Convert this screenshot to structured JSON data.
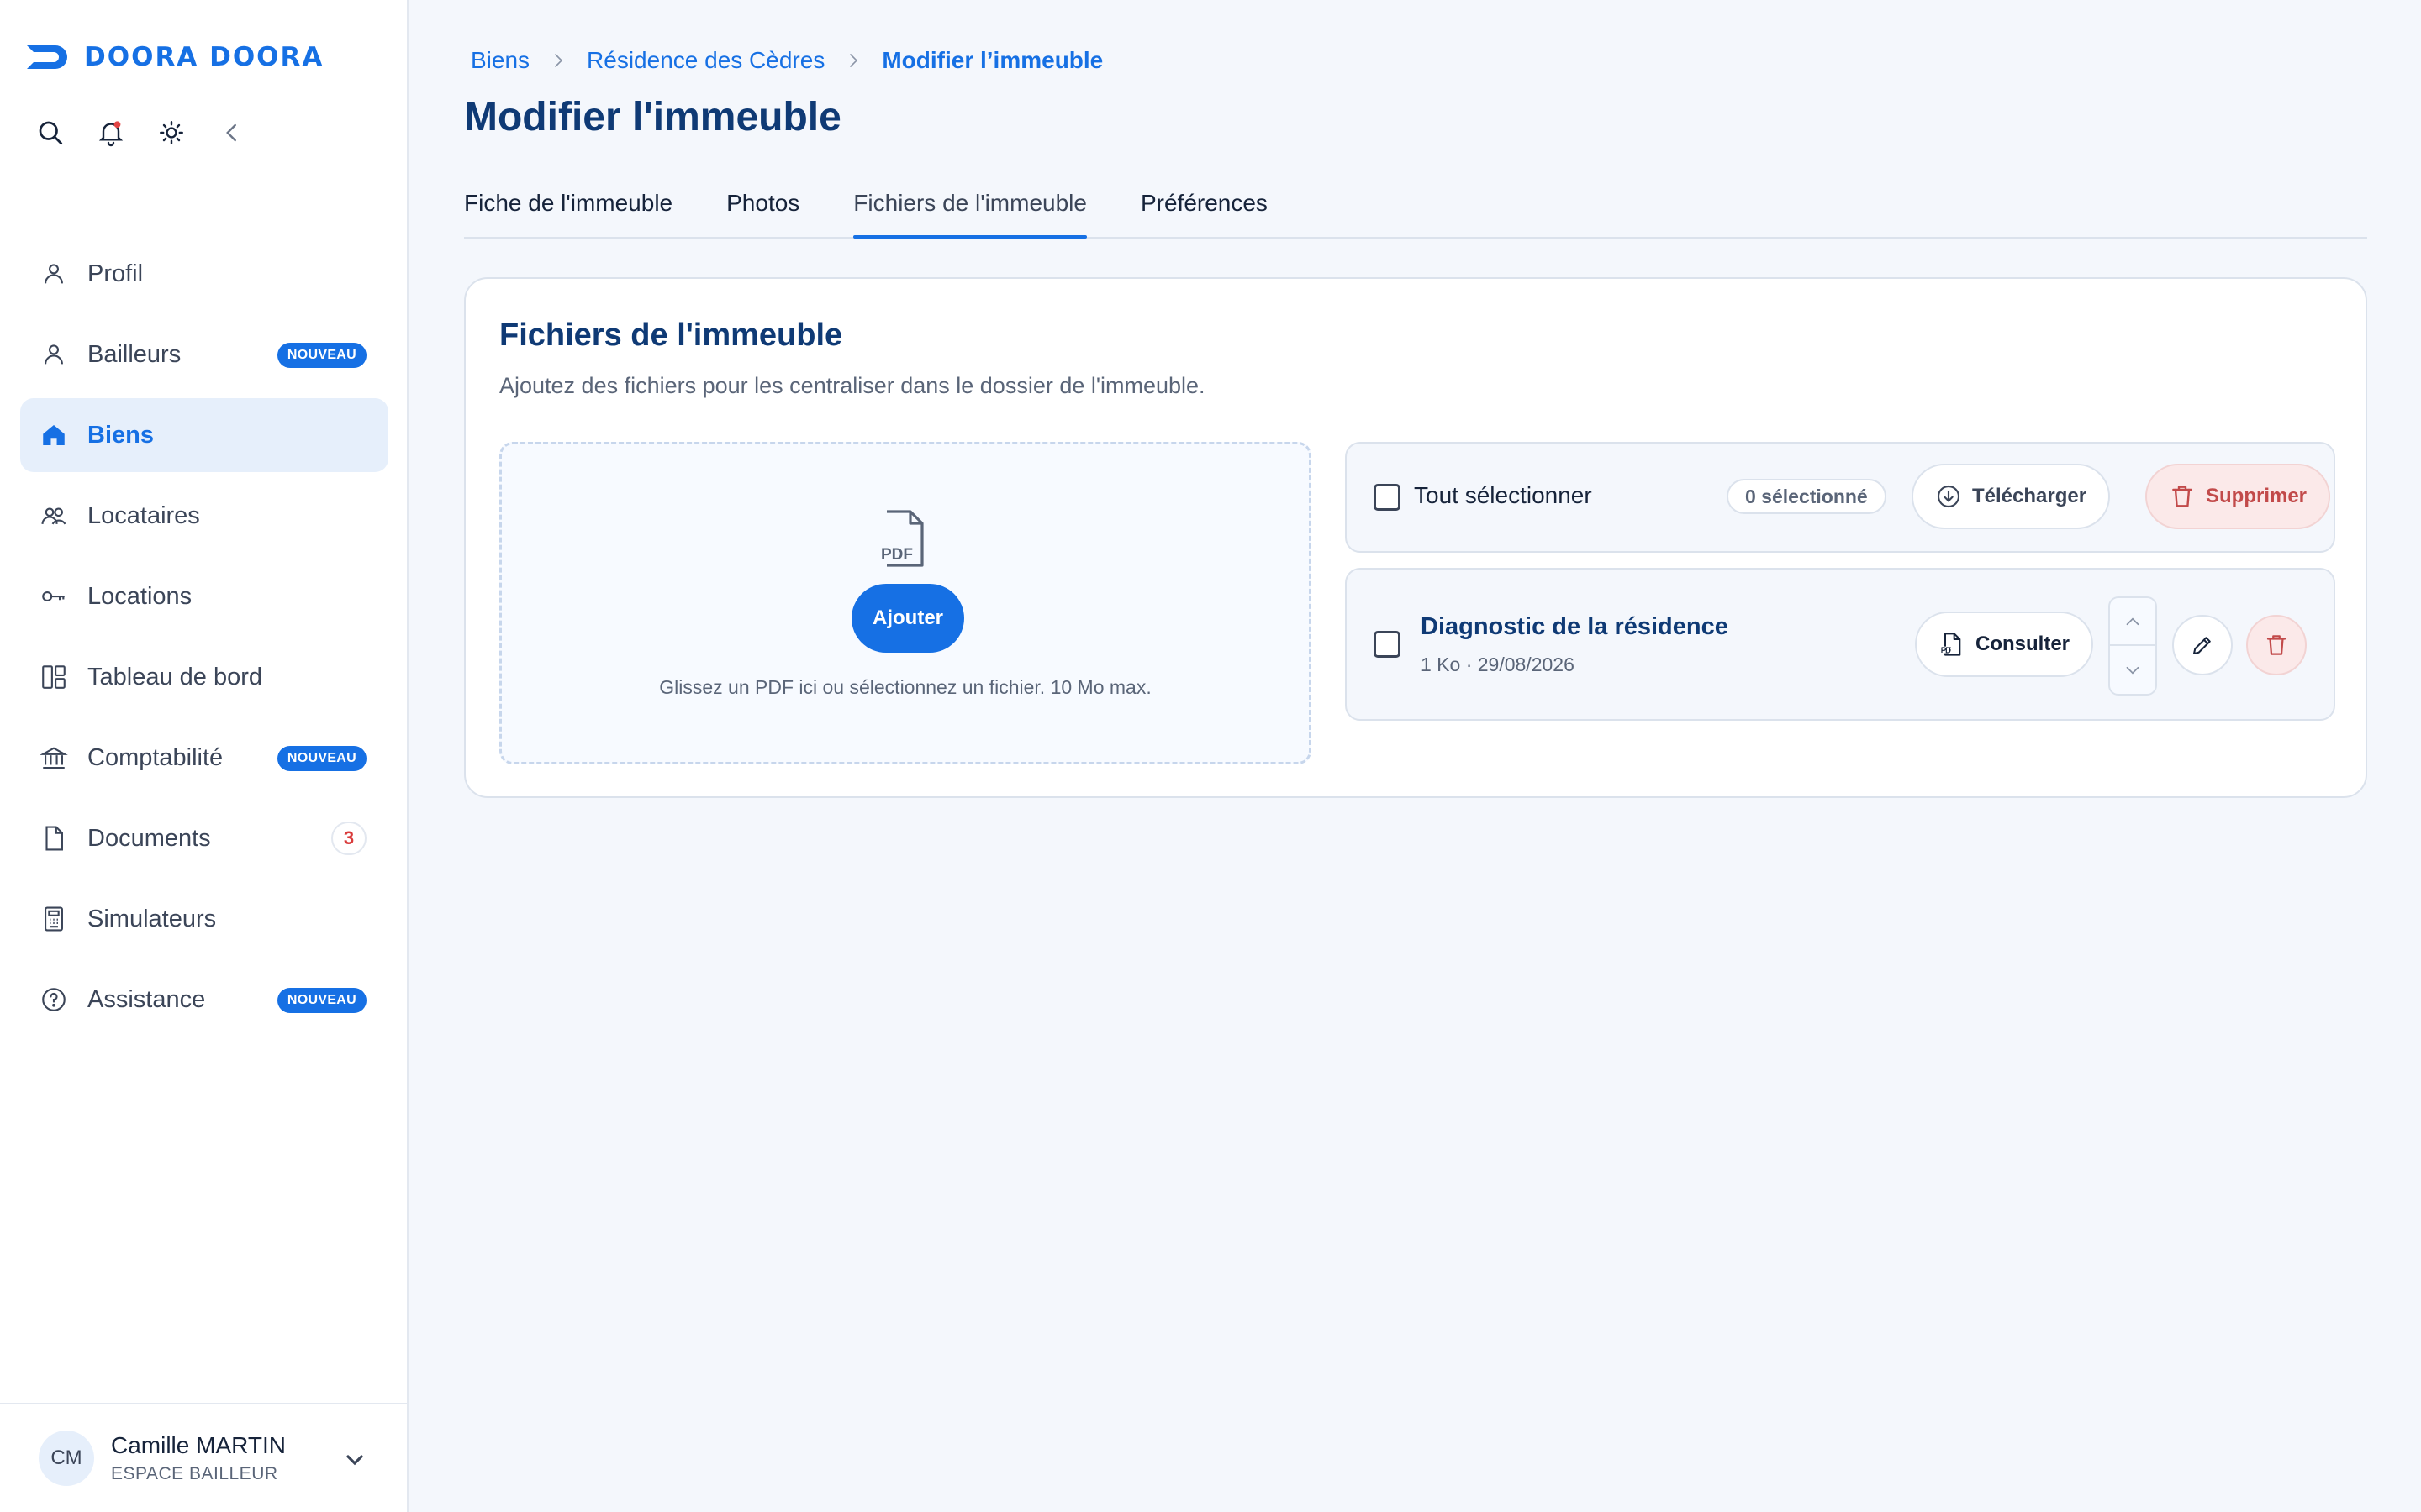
{
  "brand": {
    "name": "DOORA DOORA",
    "color": "#1670e4"
  },
  "tools": [
    {
      "icon": "search-icon"
    },
    {
      "icon": "bell-icon",
      "has_dot": true
    },
    {
      "icon": "sun-icon"
    },
    {
      "icon": "chevron-left-icon"
    }
  ],
  "sidebar": {
    "items": [
      {
        "label": "Profil",
        "icon": "user-icon",
        "active": false
      },
      {
        "label": "Bailleurs",
        "icon": "user-icon",
        "badge": "NOUVEAU"
      },
      {
        "label": "Biens",
        "icon": "home-icon",
        "active": true
      },
      {
        "label": "Locataires",
        "icon": "users-icon"
      },
      {
        "label": "Locations",
        "icon": "key-icon"
      },
      {
        "label": "Tableau de bord",
        "icon": "dashboard-icon"
      },
      {
        "label": "Comptabilité",
        "icon": "bank-icon",
        "badge": "NOUVEAU"
      },
      {
        "label": "Documents",
        "icon": "document-icon",
        "count": "3"
      },
      {
        "label": "Simulateurs",
        "icon": "calculator-icon"
      },
      {
        "label": "Assistance",
        "icon": "help-icon",
        "badge": "NOUVEAU"
      }
    ]
  },
  "user": {
    "initials": "CM",
    "name": "Camille MARTIN",
    "role": "ESPACE BAILLEUR"
  },
  "breadcrumb": {
    "items": [
      "Biens",
      "Résidence des Cèdres",
      "Modifier l’immeuble"
    ]
  },
  "page": {
    "title": "Modifier l'immeuble"
  },
  "tabs": [
    {
      "label": "Fiche de l'immeuble",
      "active": false
    },
    {
      "label": "Photos",
      "active": false
    },
    {
      "label": "Fichiers de l'immeuble",
      "active": true
    },
    {
      "label": "Préférences",
      "active": false
    }
  ],
  "files_card": {
    "title": "Fichiers de l'immeuble",
    "subtitle": "Ajoutez des fichiers pour les centraliser dans le dossier de l'immeuble.",
    "dropzone": {
      "icon_label": "PDF",
      "add_label": "Ajouter",
      "hint": "Glissez un PDF ici ou sélectionnez un fichier. 10 Mo max."
    },
    "selection": {
      "select_all_label": "Tout sélectionner",
      "count_label": "0 sélectionné",
      "download_label": "Télécharger",
      "delete_label": "Supprimer"
    },
    "files": [
      {
        "name": "Diagnostic de la résidence",
        "meta": "1 Ko · 29/08/2026",
        "consult_label": "Consulter"
      }
    ]
  }
}
